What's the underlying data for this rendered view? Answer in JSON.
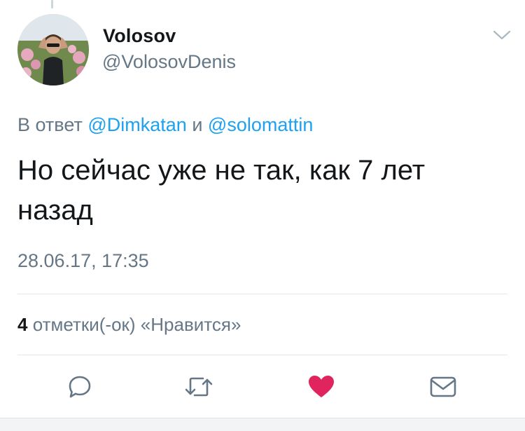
{
  "tweet": {
    "author": {
      "name": "Volosov",
      "handle": "@VolosovDenis"
    },
    "reply": {
      "prefix": "В ответ",
      "mention1": "@Dimkatan",
      "conjunction": "и",
      "mention2": "@solomattin"
    },
    "text": "Но сейчас уже не так, как 7 лет назад",
    "timestamp": "28.06.17, 17:35",
    "likes": {
      "count": "4",
      "label": "отметки(-ок) «Нравится»"
    }
  },
  "icons": {
    "caret": "chevron-down-icon",
    "reply": "reply-icon",
    "retweet": "retweet-icon",
    "like": "heart-icon",
    "message": "envelope-icon"
  },
  "colors": {
    "link": "#1da1f2",
    "secondary_text": "#657786",
    "icon": "#657786",
    "like_active": "#e0245e",
    "divider": "#e1e8ed"
  }
}
